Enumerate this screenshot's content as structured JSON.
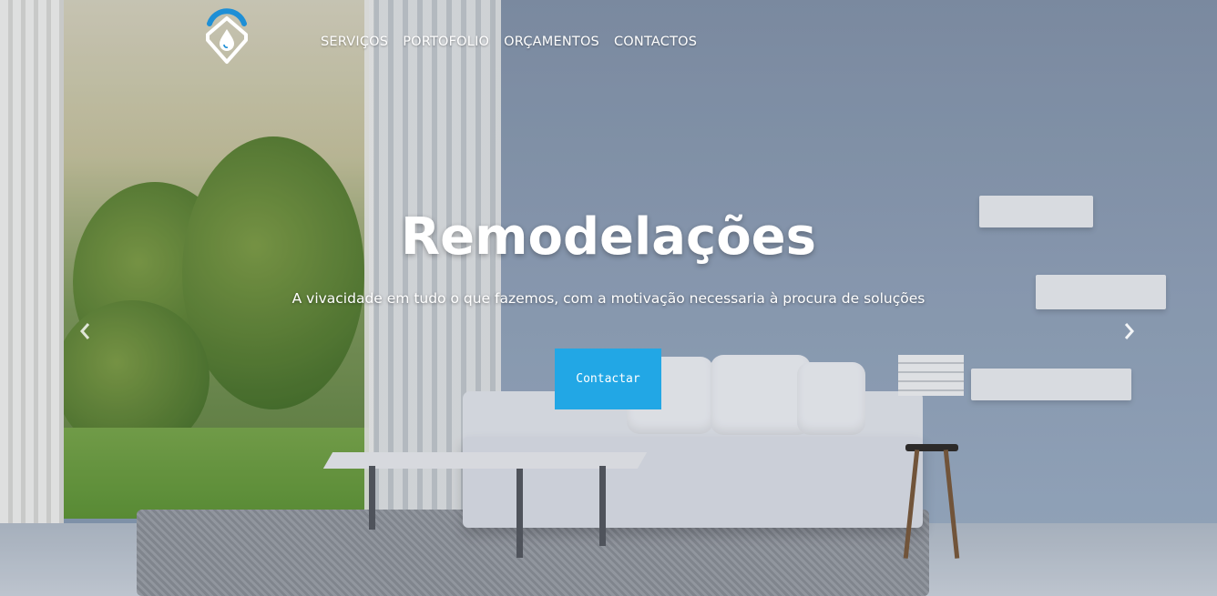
{
  "nav": {
    "items": [
      {
        "label": "SERVIÇOS"
      },
      {
        "label": "PORTOFOLIO"
      },
      {
        "label": "ORÇAMENTOS"
      },
      {
        "label": "CONTACTOS"
      }
    ]
  },
  "hero": {
    "title": "Remodelações",
    "subtitle": "A vivacidade em tudo o que fazemos, com a motivação necessaria à procura de soluções",
    "cta_label": "Contactar"
  },
  "carousel": {
    "prev_icon": "chevron-left-icon",
    "next_icon": "chevron-right-icon"
  },
  "colors": {
    "accent": "#22a7e5",
    "logo_blue": "#1e8fd6"
  }
}
